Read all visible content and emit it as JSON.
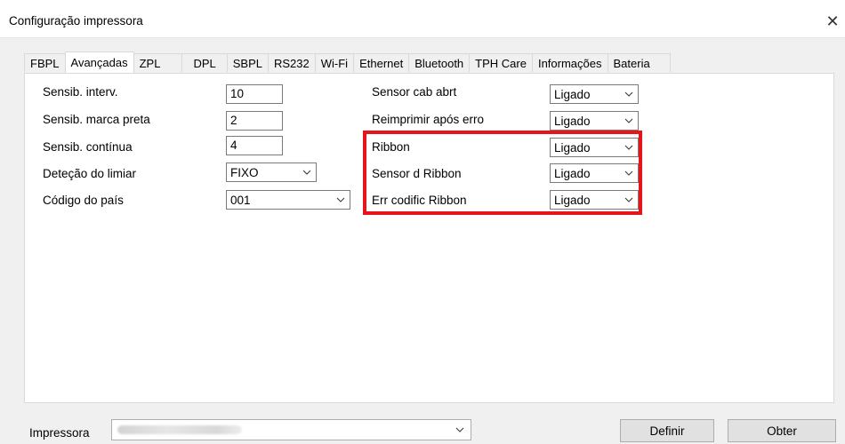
{
  "window": {
    "title": "Configuração impressora",
    "close_glyph": "✕"
  },
  "tabs": [
    "FBPL",
    "Avançadas",
    "ZPL",
    "DPL",
    "SBPL",
    "RS232",
    "Wi-Fi",
    "Ethernet",
    "Bluetooth",
    "TPH Care",
    "Informações",
    "Bateria"
  ],
  "active_tab": "Avançadas",
  "left_fields": {
    "sensib_interv": {
      "label": "Sensib. interv.",
      "value": "10"
    },
    "sensib_marca_preta": {
      "label": "Sensib. marca preta",
      "value": "2"
    },
    "sensib_continua": {
      "label": "Sensib. contínua",
      "value": "4"
    },
    "detecao_limiar": {
      "label": "Deteção do limiar",
      "value": "FIXO"
    },
    "codigo_pais": {
      "label": "Código do país",
      "value": "001"
    }
  },
  "right_fields": {
    "sensor_cab_abrt": {
      "label": "Sensor cab abrt",
      "value": "Ligado"
    },
    "reimprimir_apos_erro": {
      "label": "Reimprimir após erro",
      "value": "Ligado"
    },
    "ribbon": {
      "label": "Ribbon",
      "value": "Ligado"
    },
    "sensor_d_ribbon": {
      "label": "Sensor d Ribbon",
      "value": "Ligado"
    },
    "err_codific_ribbon": {
      "label": "Err codific Ribbon",
      "value": "Ligado"
    }
  },
  "bottom": {
    "printer_label": "Impressora",
    "define_button": "Definir",
    "obtain_button": "Obter"
  },
  "colors": {
    "highlight": "#e8141b",
    "window_bg": "#f0f0f0",
    "panel_bg": "#ffffff"
  },
  "icons": {
    "close": "close-icon",
    "dropdown": "chevron-down-icon"
  }
}
